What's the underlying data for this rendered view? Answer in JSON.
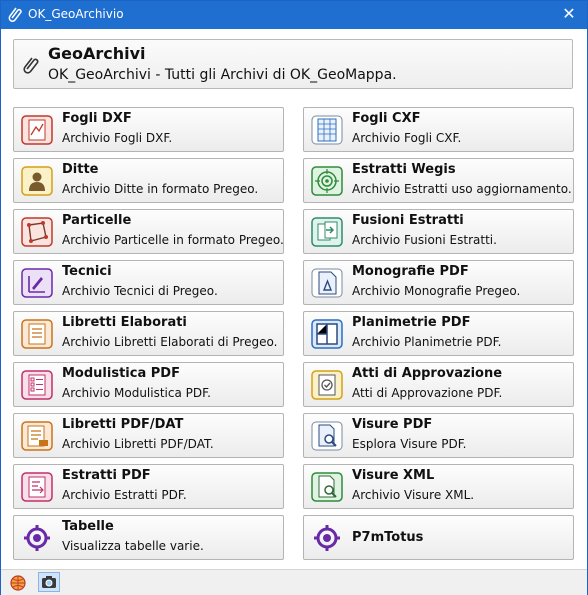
{
  "window": {
    "title": "OK_GeoArchivio",
    "close_glyph": "✕"
  },
  "header": {
    "title": "GeoArchivi",
    "subtitle": "OK_GeoArchivi - Tutti gli Archivi di OK_GeoMappa."
  },
  "left_buttons": [
    {
      "title": "Fogli DXF",
      "desc": "Archivio Fogli DXF.",
      "icon": "dxf-sheet-icon"
    },
    {
      "title": "Ditte",
      "desc": "Archivio Ditte in formato Pregeo.",
      "icon": "person-icon"
    },
    {
      "title": "Particelle",
      "desc": "Archivio Particelle in formato Pregeo.",
      "icon": "parcel-icon"
    },
    {
      "title": "Tecnici",
      "desc": "Archivio Tecnici di Pregeo.",
      "icon": "technician-icon"
    },
    {
      "title": "Libretti Elaborati",
      "desc": "Archivio Libretti Elaborati di Pregeo.",
      "icon": "booklet-icon"
    },
    {
      "title": "Modulistica PDF",
      "desc": "Archivio Modulistica PDF.",
      "icon": "forms-icon"
    },
    {
      "title": "Libretti PDF/DAT",
      "desc": "Archivio Libretti PDF/DAT.",
      "icon": "booklet-pdf-icon"
    },
    {
      "title": "Estratti PDF",
      "desc": "Archivio Estratti PDF.",
      "icon": "extract-pdf-icon"
    },
    {
      "title": "Tabelle",
      "desc": "Visualizza tabelle varie.",
      "icon": "gear-icon"
    }
  ],
  "right_buttons": [
    {
      "title": "Fogli CXF",
      "desc": "Archivio Fogli CXF.",
      "icon": "cxf-sheet-icon"
    },
    {
      "title": "Estratti Wegis",
      "desc": "Archivio Estratti uso aggiornamento.",
      "icon": "target-icon"
    },
    {
      "title": "Fusioni Estratti",
      "desc": "Archivio Fusioni Estratti.",
      "icon": "merge-icon"
    },
    {
      "title": "Monografie PDF",
      "desc": "Archivio Monografie Pregeo.",
      "icon": "monograph-icon"
    },
    {
      "title": "Planimetrie PDF",
      "desc": "Archivio Planimetrie PDF.",
      "icon": "floorplan-icon"
    },
    {
      "title": "Atti di Approvazione",
      "desc": "Atti di Approvazione PDF.",
      "icon": "approval-icon"
    },
    {
      "title": "Visure PDF",
      "desc": "Esplora Visure PDF.",
      "icon": "search-doc-icon"
    },
    {
      "title": "Visure XML",
      "desc": "Archivio Visure XML.",
      "icon": "xml-doc-icon"
    },
    {
      "title": "P7mTotus",
      "desc": "",
      "icon": "gear-icon"
    }
  ],
  "statusbar": {
    "icons": [
      "globe-tool-icon",
      "camera-icon"
    ]
  },
  "colors": {
    "titlebar": "#1f6fd1",
    "icon_red": "#c0392b",
    "icon_blue": "#2a6fc0",
    "icon_green": "#2f8c3a",
    "icon_purple": "#6a2aa8",
    "icon_orange": "#c8741a",
    "icon_yellow": "#d4a017",
    "icon_pink": "#c0306a"
  }
}
